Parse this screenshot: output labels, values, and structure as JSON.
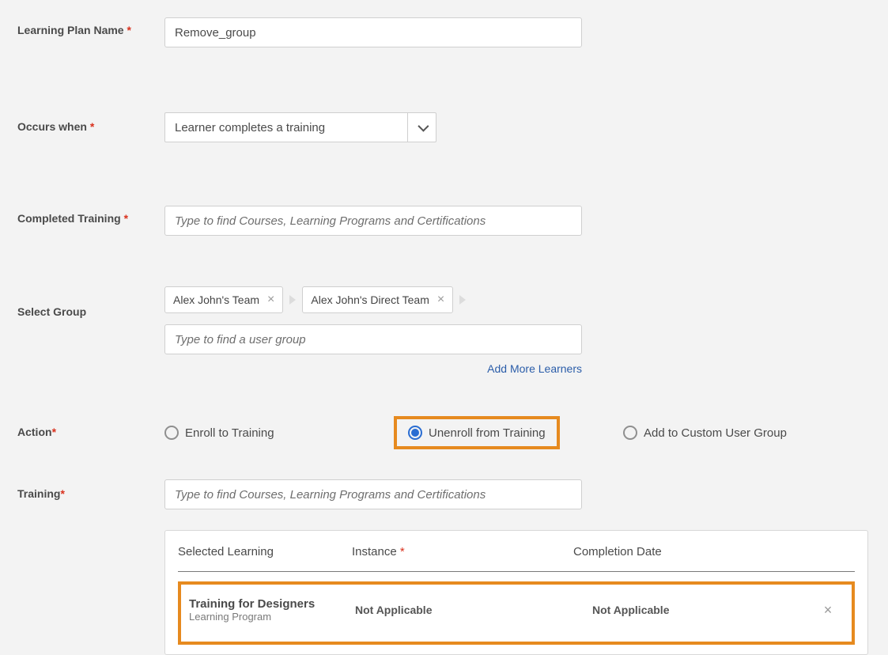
{
  "labels": {
    "learningPlanName": "Learning Plan Name",
    "occursWhen": "Occurs when",
    "completedTraining": "Completed Training",
    "selectGroup": "Select Group",
    "action": "Action",
    "training": "Training"
  },
  "fields": {
    "planName": "Remove_group",
    "occursWhenValue": "Learner completes a training",
    "completedTrainingPlaceholder": "Type to find Courses, Learning Programs and Certifications",
    "groupSearchPlaceholder": "Type to find a user group",
    "trainingPlaceholder": "Type to find Courses, Learning Programs and Certifications"
  },
  "groups": [
    {
      "label": "Alex John's Team"
    },
    {
      "label": "Alex John's Direct Team"
    }
  ],
  "addMoreLearners": "Add More Learners",
  "actions": {
    "enroll": "Enroll to Training",
    "unenroll": "Unenroll from Training",
    "addToGroup": "Add to Custom User Group",
    "selected": "unenroll"
  },
  "table": {
    "headers": {
      "selectedLearning": "Selected Learning",
      "instance": "Instance",
      "completionDate": "Completion Date"
    },
    "row": {
      "title": "Training for Designers",
      "subtitle": "Learning Program",
      "instance": "Not Applicable",
      "completion": "Not Applicable"
    }
  }
}
